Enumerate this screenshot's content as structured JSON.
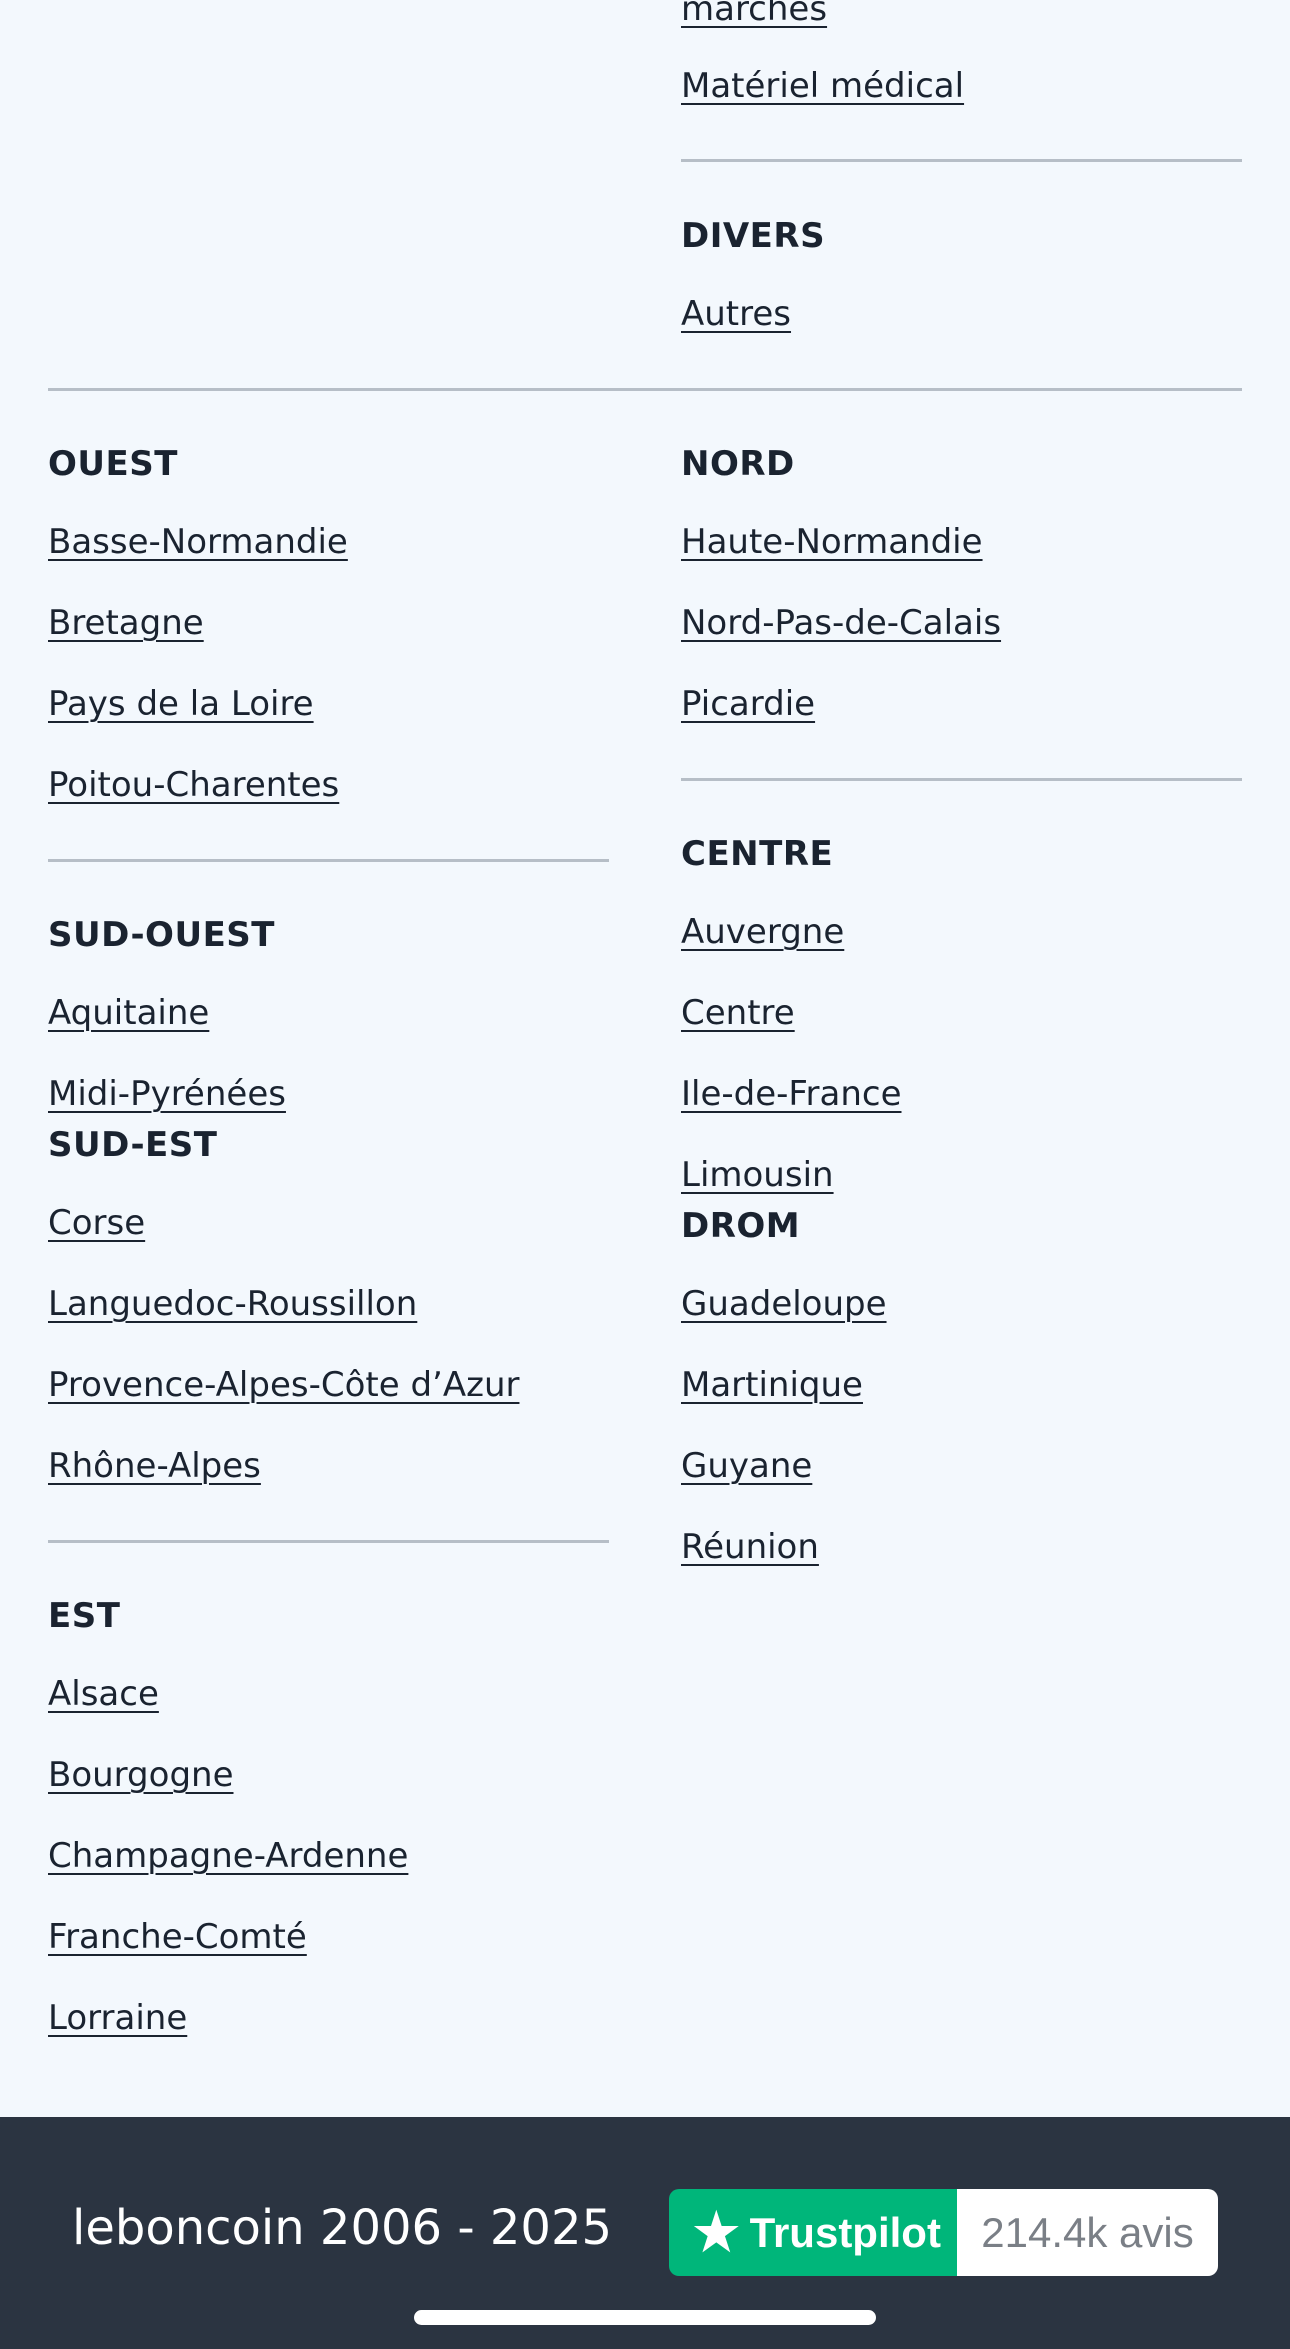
{
  "top_partial_link": "marchés",
  "top_link": "Matériel médical",
  "divers": {
    "heading": "DIVERS",
    "links": [
      "Autres"
    ]
  },
  "ouest": {
    "heading": "OUEST",
    "links": [
      "Basse-Normandie",
      "Bretagne",
      "Pays de la Loire",
      "Poitou-Charentes"
    ]
  },
  "nord": {
    "heading": "NORD",
    "links": [
      "Haute-Normandie",
      "Nord-Pas-de-Calais",
      "Picardie"
    ]
  },
  "sud_ouest": {
    "heading": "SUD-OUEST",
    "links": [
      "Aquitaine",
      "Midi-Pyrénées"
    ]
  },
  "centre": {
    "heading": "CENTRE",
    "links": [
      "Auvergne",
      "Centre",
      "Ile-de-France",
      "Limousin"
    ]
  },
  "sud_est": {
    "heading": "SUD-EST",
    "links": [
      "Corse",
      "Languedoc-Roussillon",
      "Provence-Alpes-Côte d’Azur",
      "Rhône-Alpes"
    ]
  },
  "drom": {
    "heading": "DROM",
    "links": [
      "Guadeloupe",
      "Martinique",
      "Guyane",
      "Réunion"
    ]
  },
  "est": {
    "heading": "EST",
    "links": [
      "Alsace",
      "Bourgogne",
      "Champagne-Ardenne",
      "Franche-Comté",
      "Lorraine"
    ]
  },
  "footer": {
    "copyright": "leboncoin 2006 - 2025",
    "trustpilot_label": "Trustpilot",
    "trustpilot_star": "★",
    "trustpilot_count": "214.4k avis"
  },
  "colors": {
    "background": "#f3f8fd",
    "footer": "#2b3441",
    "trustpilot_green": "#00b67a"
  }
}
